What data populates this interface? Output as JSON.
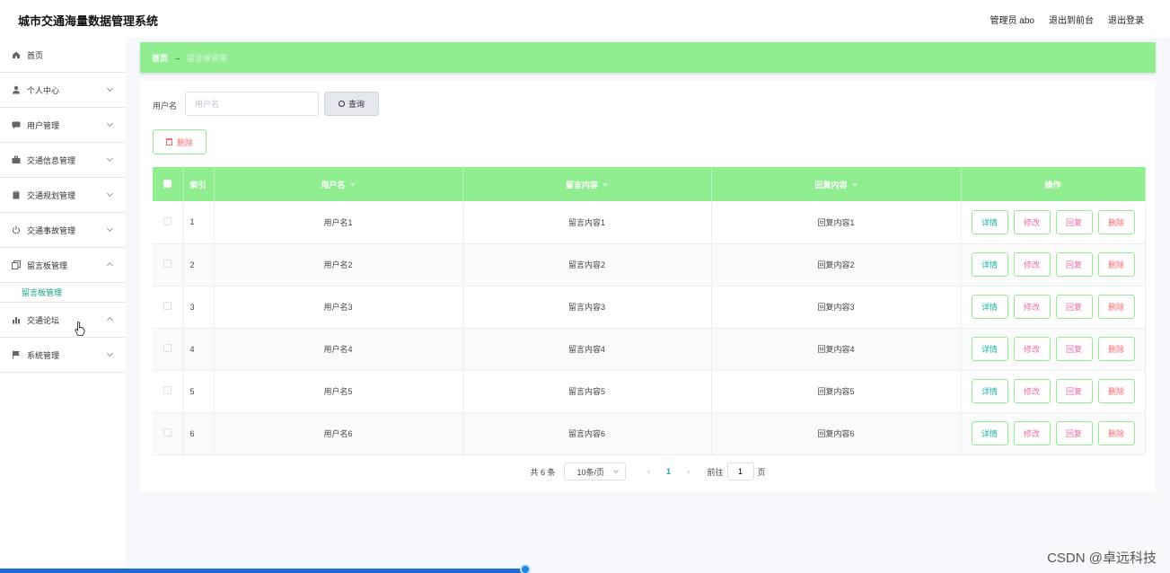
{
  "header": {
    "app_title": "城市交通海量数据管理系统",
    "user": "管理员 abo",
    "back_front": "退出到前台",
    "logout": "退出登录"
  },
  "sidebar": {
    "items": [
      {
        "label": "首页",
        "icon": "home-icon"
      },
      {
        "label": "个人中心",
        "icon": "user-icon"
      },
      {
        "label": "用户管理",
        "icon": "chat-icon"
      },
      {
        "label": "交通信息管理",
        "icon": "briefcase-icon"
      },
      {
        "label": "交通规划管理",
        "icon": "clipboard-icon"
      },
      {
        "label": "交通事故管理",
        "icon": "power-icon"
      },
      {
        "label": "留言板管理",
        "icon": "copy-icon"
      },
      {
        "label": "交通论坛",
        "icon": "bar-chart-icon"
      },
      {
        "label": "系统管理",
        "icon": "flag-icon"
      }
    ],
    "sub_item": "留言板管理"
  },
  "breadcrumb": {
    "home": "首页",
    "separator": "→",
    "current": "留言板管理"
  },
  "search": {
    "label": "用户名",
    "placeholder": "用户名",
    "button": "查询"
  },
  "toolbar": {
    "delete_label": "删除"
  },
  "table": {
    "headers": {
      "index": "索引",
      "username": "用户名",
      "message": "留言内容",
      "reply": "回复内容",
      "actions": "操作"
    },
    "rows": [
      {
        "index": "1",
        "username": "用户名1",
        "message": "留言内容1",
        "reply": "回复内容1"
      },
      {
        "index": "2",
        "username": "用户名2",
        "message": "留言内容2",
        "reply": "回复内容2"
      },
      {
        "index": "3",
        "username": "用户名3",
        "message": "留言内容3",
        "reply": "回复内容3"
      },
      {
        "index": "4",
        "username": "用户名4",
        "message": "留言内容4",
        "reply": "回复内容4"
      },
      {
        "index": "5",
        "username": "用户名5",
        "message": "留言内容5",
        "reply": "回复内容5"
      },
      {
        "index": "6",
        "username": "用户名6",
        "message": "留言内容6",
        "reply": "回复内容6"
      }
    ],
    "actions": {
      "detail": "详情",
      "edit": "修改",
      "reply": "回复",
      "delete": "删除"
    }
  },
  "pagination": {
    "total": "共 6 条",
    "page_size": "10条/页",
    "current_page": "1",
    "goto_label": "前往",
    "goto_value": "1",
    "page_suffix": "页"
  },
  "watermark": "CSDN @卓远科技",
  "colors": {
    "accent_green": "#90ee90",
    "teal": "#17b3a3",
    "pink": "#e66ba8",
    "danger": "#f56c6c"
  }
}
